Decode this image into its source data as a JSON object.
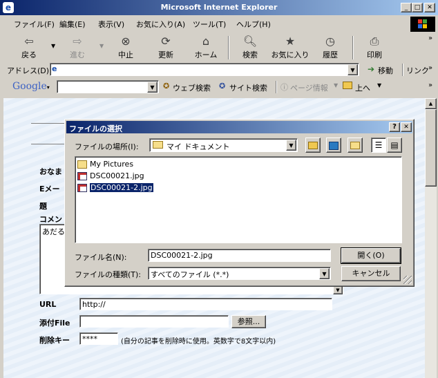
{
  "window": {
    "title": "Microsoft Internet Explorer"
  },
  "menu": [
    "ファイル(F)",
    "編集(E)",
    "表示(V)",
    "お気に入り(A)",
    "ツール(T)",
    "ヘルプ(H)"
  ],
  "toolbar": {
    "back": "戻る",
    "forward": "進む",
    "stop": "中止",
    "refresh": "更新",
    "home": "ホーム",
    "search": "検索",
    "favorites": "お気に入り",
    "history": "履歴",
    "print": "印刷"
  },
  "address": {
    "label": "アドレス(D)",
    "value": "",
    "go": "移動",
    "links": "リンク"
  },
  "google": {
    "logo": "Google",
    "web_search": "ウェブ検索",
    "site_search": "サイト検索",
    "page_info": "ページ情報",
    "up": "上へ"
  },
  "form": {
    "name_label": "おなま",
    "email_label": "Eメー",
    "subject_label": "題",
    "comment_label": "コメン",
    "comment_value": "あだる",
    "url_label": "URL",
    "url_value": "http://",
    "attach_label": "添付File",
    "browse_button": "参照...",
    "delete_key_label": "削除キー",
    "delete_key_value": "****",
    "delete_key_note": "(自分の記事を削除時に使用。英数字で8文字以内)"
  },
  "dialog": {
    "title": "ファイルの選択",
    "location_label": "ファイルの場所(I):",
    "location_value": "マイ ドキュメント",
    "files": [
      {
        "name": "My Pictures",
        "icon": "folder-icon",
        "selected": false
      },
      {
        "name": "DSC00021.jpg",
        "icon": "image-file-icon",
        "selected": false
      },
      {
        "name": "DSC00021-2.jpg",
        "icon": "image-file-icon",
        "selected": true
      }
    ],
    "filename_label": "ファイル名(N):",
    "filename_value": "DSC00021-2.jpg",
    "filetype_label": "ファイルの種類(T):",
    "filetype_value": "すべてのファイル (*.*)",
    "open_button": "開く(O)",
    "cancel_button": "キャンセル"
  },
  "colors": {
    "title_start": "#0a246a",
    "title_end": "#a6caf0",
    "selection": "#0a246a",
    "face": "#d4d0c8"
  }
}
